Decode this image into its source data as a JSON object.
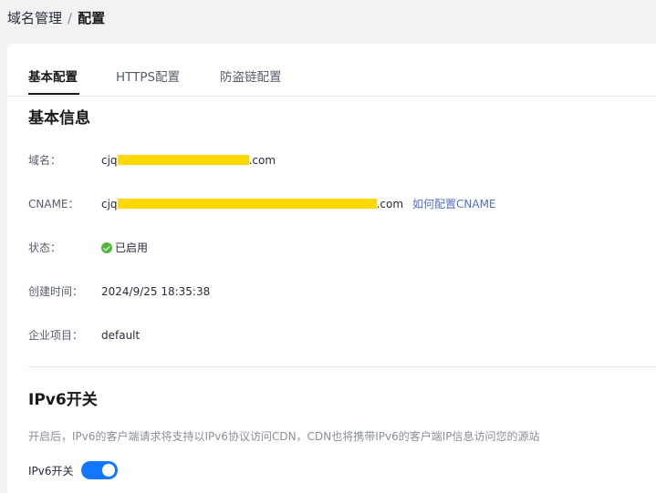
{
  "breadcrumb": {
    "parent": "域名管理",
    "separator": "/",
    "current": "配置"
  },
  "tabs": [
    {
      "label": "基本配置",
      "active": true
    },
    {
      "label": "HTTPS配置",
      "active": false
    },
    {
      "label": "防盗链配置",
      "active": false
    }
  ],
  "basic_info": {
    "title": "基本信息",
    "domain": {
      "label": "域名：",
      "prefix": "cjq",
      "suffix": ".com"
    },
    "cname": {
      "label": "CNAME：",
      "prefix": "cjq",
      "suffix": ".com",
      "link": "如何配置CNAME"
    },
    "status": {
      "label": "状态：",
      "value": "已启用",
      "color": "#50b83c"
    },
    "created": {
      "label": "创建时间：",
      "value": "2024/9/25 18:35:38"
    },
    "project": {
      "label": "企业项目：",
      "value": "default"
    }
  },
  "ipv6": {
    "title": "IPv6开关",
    "description": "开启后，IPv6的客户端请求将支持以IPv6协议访问CDN，CDN也将携带IPv6的客户端IP信息访问您的源站",
    "toggle_label": "IPv6开关",
    "enabled": true
  },
  "colors": {
    "accent": "#1476ff",
    "link": "#526ecc",
    "redaction": "#ffd800"
  }
}
